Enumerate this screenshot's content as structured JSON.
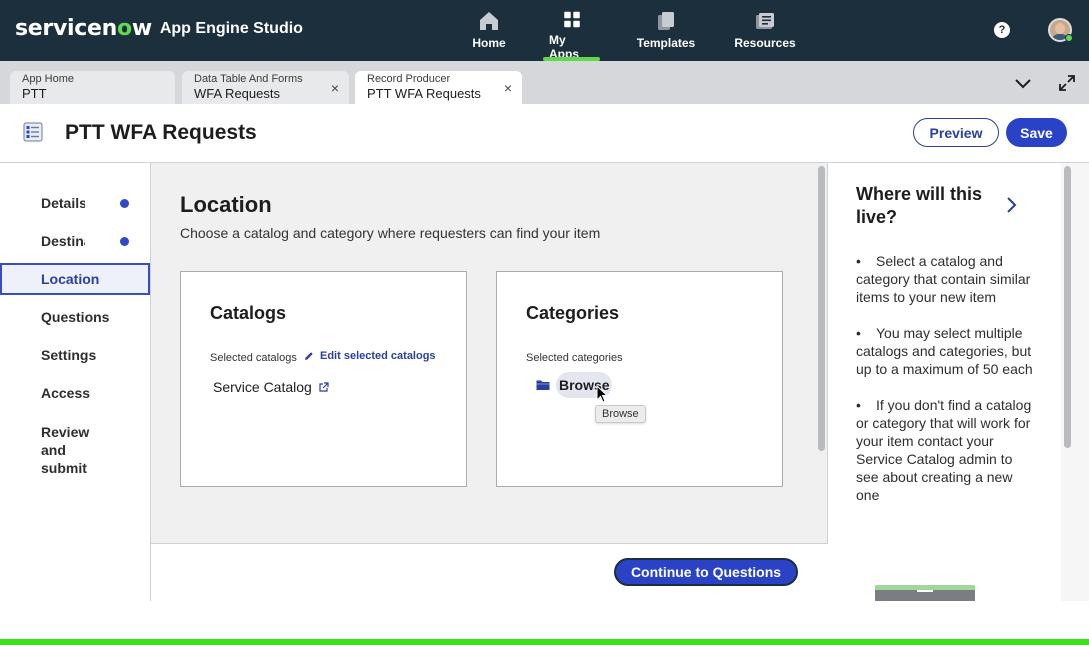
{
  "topnav": {
    "brand": "servicenow",
    "app_name": "App Engine Studio",
    "items": [
      {
        "label": "Home",
        "icon": "home-icon"
      },
      {
        "label": "My Apps",
        "icon": "grid-icon"
      },
      {
        "label": "Templates",
        "icon": "templates-icon"
      },
      {
        "label": "Resources",
        "icon": "resources-icon"
      }
    ],
    "active_item": "My Apps",
    "help_glyph": "?",
    "accent_color": "#62d84e"
  },
  "tabs": [
    {
      "kind": "App Home",
      "name": "PTT",
      "closable": false
    },
    {
      "kind": "Data Table And Forms",
      "name": "WFA Requests",
      "closable": true
    },
    {
      "kind": "Record Producer",
      "name": "PTT WFA Requests",
      "closable": true
    }
  ],
  "tab_close_glyph": "×",
  "header": {
    "title": "PTT WFA Requests",
    "preview_label": "Preview",
    "save_label": "Save",
    "primary_color": "#2a43c6"
  },
  "steps": [
    {
      "label": "Details",
      "complete": true
    },
    {
      "label": "Destination",
      "complete": true
    },
    {
      "label": "Location",
      "active": true
    },
    {
      "label": "Questions"
    },
    {
      "label": "Settings"
    },
    {
      "label": "Access"
    },
    {
      "label": "Review and submit"
    }
  ],
  "location": {
    "title": "Location",
    "subtitle": "Choose a catalog and category where requesters can find your item",
    "catalogs": {
      "title": "Catalogs",
      "selected_label": "Selected catalogs",
      "edit_label": "Edit selected catalogs",
      "items": [
        "Service Catalog"
      ]
    },
    "categories": {
      "title": "Categories",
      "selected_label": "Selected categories",
      "browse_label": "Browse",
      "tooltip": "Browse"
    },
    "continue_label": "Continue to Questions"
  },
  "side": {
    "title": "Where will this live?",
    "tips": [
      "Select a catalog and category that contain similar items to your new item",
      "You may select multiple catalogs and categories, but up to a maximum of 50 each",
      "If you don't find a catalog or category that will work for your item contact your Service Catalog admin to see about creating a new one"
    ]
  }
}
